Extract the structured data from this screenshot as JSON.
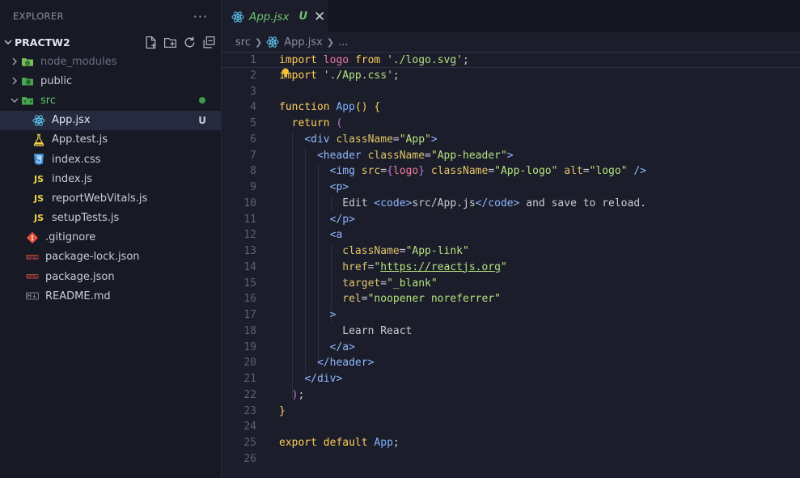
{
  "explorer": {
    "title": "EXPLORER",
    "more": "···"
  },
  "project": {
    "name": "PRACTW2"
  },
  "tree": [
    {
      "label": "node_modules",
      "type": "folder",
      "state": "collapsed",
      "dim": true
    },
    {
      "label": "public",
      "type": "folder",
      "state": "collapsed"
    },
    {
      "label": "src",
      "type": "folder",
      "state": "expanded",
      "color": "green",
      "modified": true
    },
    {
      "label": "App.jsx",
      "type": "react",
      "active": true,
      "badge": "U"
    },
    {
      "label": "App.test.js",
      "type": "test"
    },
    {
      "label": "index.css",
      "type": "css"
    },
    {
      "label": "index.js",
      "type": "js"
    },
    {
      "label": "reportWebVitals.js",
      "type": "js"
    },
    {
      "label": "setupTests.js",
      "type": "js"
    },
    {
      "label": ".gitignore",
      "type": "git"
    },
    {
      "label": "package-lock.json",
      "type": "npm"
    },
    {
      "label": "package.json",
      "type": "npm"
    },
    {
      "label": "README.md",
      "type": "md"
    }
  ],
  "tab": {
    "label": "App.jsx",
    "badge": "U",
    "close": "✕"
  },
  "breadcrumb": {
    "folder": "src",
    "file": "App.jsx",
    "more": "..."
  },
  "code": [
    {
      "n": "1",
      "t": [
        [
          "kw",
          "import "
        ],
        [
          "var",
          "logo "
        ],
        [
          "kw",
          "from "
        ],
        [
          "str",
          "'./logo.svg'"
        ],
        [
          "pun",
          ";"
        ]
      ]
    },
    {
      "n": "2",
      "t": [
        [
          "kw",
          "import "
        ],
        [
          "str",
          "'./App.css'"
        ],
        [
          "pun",
          ";"
        ]
      ]
    },
    {
      "n": "3",
      "t": []
    },
    {
      "n": "4",
      "t": [
        [
          "kw",
          "function "
        ],
        [
          "fn",
          "App"
        ],
        [
          "kw",
          "() {"
        ]
      ]
    },
    {
      "n": "5",
      "t": [
        [
          "txt",
          "  "
        ],
        [
          "kw",
          "return "
        ],
        [
          "br",
          "("
        ]
      ]
    },
    {
      "n": "6",
      "t": [
        [
          "txt",
          "    "
        ],
        [
          "tag",
          "<div "
        ],
        [
          "attr",
          "className"
        ],
        [
          "pun",
          "="
        ],
        [
          "str",
          "\"App\""
        ],
        [
          "tag",
          ">"
        ]
      ]
    },
    {
      "n": "7",
      "t": [
        [
          "txt",
          "      "
        ],
        [
          "tag",
          "<header "
        ],
        [
          "attr",
          "className"
        ],
        [
          "pun",
          "="
        ],
        [
          "str",
          "\"App-header\""
        ],
        [
          "tag",
          ">"
        ]
      ]
    },
    {
      "n": "8",
      "t": [
        [
          "txt",
          "        "
        ],
        [
          "tag",
          "<img "
        ],
        [
          "attr",
          "src"
        ],
        [
          "pun",
          "="
        ],
        [
          "br",
          "{"
        ],
        [
          "var",
          "logo"
        ],
        [
          "br",
          "} "
        ],
        [
          "attr",
          "className"
        ],
        [
          "pun",
          "="
        ],
        [
          "str",
          "\"App-logo\" "
        ],
        [
          "attr",
          "alt"
        ],
        [
          "pun",
          "="
        ],
        [
          "str",
          "\"logo\" "
        ],
        [
          "tag",
          "/>"
        ]
      ]
    },
    {
      "n": "9",
      "t": [
        [
          "txt",
          "        "
        ],
        [
          "tag",
          "<p>"
        ]
      ]
    },
    {
      "n": "10",
      "t": [
        [
          "txt",
          "          Edit "
        ],
        [
          "tag",
          "<code>"
        ],
        [
          "txt",
          "src/App.js"
        ],
        [
          "tag",
          "</code>"
        ],
        [
          "txt",
          " and save to reload."
        ]
      ]
    },
    {
      "n": "11",
      "t": [
        [
          "txt",
          "        "
        ],
        [
          "tag",
          "</p>"
        ]
      ]
    },
    {
      "n": "12",
      "t": [
        [
          "txt",
          "        "
        ],
        [
          "tag",
          "<a"
        ]
      ]
    },
    {
      "n": "13",
      "t": [
        [
          "txt",
          "          "
        ],
        [
          "attr",
          "className"
        ],
        [
          "pun",
          "="
        ],
        [
          "str",
          "\"App-link\""
        ]
      ]
    },
    {
      "n": "14",
      "t": [
        [
          "txt",
          "          "
        ],
        [
          "attr",
          "href"
        ],
        [
          "pun",
          "="
        ],
        [
          "str",
          "\""
        ],
        [
          "url",
          "https://reactjs.org"
        ],
        [
          "str",
          "\""
        ]
      ]
    },
    {
      "n": "15",
      "t": [
        [
          "txt",
          "          "
        ],
        [
          "attr",
          "target"
        ],
        [
          "pun",
          "="
        ],
        [
          "str",
          "\"_blank\""
        ]
      ]
    },
    {
      "n": "16",
      "t": [
        [
          "txt",
          "          "
        ],
        [
          "attr",
          "rel"
        ],
        [
          "pun",
          "="
        ],
        [
          "str",
          "\"noopener noreferrer\""
        ]
      ]
    },
    {
      "n": "17",
      "t": [
        [
          "txt",
          "        "
        ],
        [
          "tag",
          ">"
        ]
      ]
    },
    {
      "n": "18",
      "t": [
        [
          "txt",
          "          Learn React"
        ]
      ]
    },
    {
      "n": "19",
      "t": [
        [
          "txt",
          "        "
        ],
        [
          "tag",
          "</a>"
        ]
      ]
    },
    {
      "n": "20",
      "t": [
        [
          "txt",
          "      "
        ],
        [
          "tag",
          "</header>"
        ]
      ]
    },
    {
      "n": "21",
      "t": [
        [
          "txt",
          "    "
        ],
        [
          "tag",
          "</div>"
        ]
      ]
    },
    {
      "n": "22",
      "t": [
        [
          "txt",
          "  "
        ],
        [
          "br",
          ")"
        ],
        [
          "pun",
          ";"
        ]
      ]
    },
    {
      "n": "23",
      "t": [
        [
          "kw",
          "}"
        ]
      ]
    },
    {
      "n": "24",
      "t": []
    },
    {
      "n": "25",
      "t": [
        [
          "kw",
          "export "
        ],
        [
          "kw",
          "default "
        ],
        [
          "fn",
          "App"
        ],
        [
          "pun",
          ";"
        ]
      ]
    },
    {
      "n": "26",
      "t": []
    }
  ]
}
